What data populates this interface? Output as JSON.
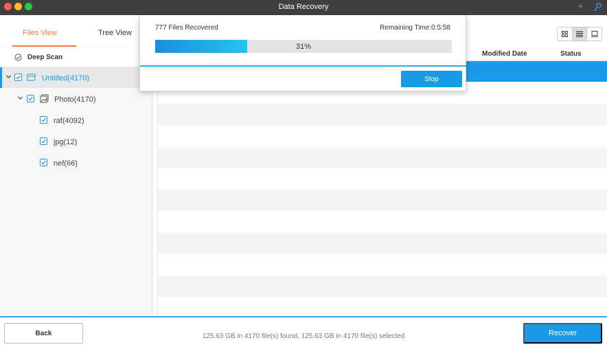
{
  "window": {
    "title": "Data Recovery"
  },
  "sidebar": {
    "tabs": [
      "Files View",
      "Tree View"
    ],
    "active_tab": "Files View",
    "deep_scan_label": "Deep Scan",
    "tree": [
      {
        "label": "Untitled(4170)",
        "icon": "drive-icon",
        "checked": true,
        "expanded": true,
        "selected": true
      },
      {
        "label": "Photo(4170)",
        "icon": "photo-folder-icon",
        "checked": true,
        "expanded": true
      },
      {
        "label": "raf(4092)",
        "checked": true
      },
      {
        "label": "jpg(12)",
        "checked": true
      },
      {
        "label": "nef(66)",
        "checked": true
      }
    ]
  },
  "main": {
    "columns": [
      "Modified Date",
      "Status"
    ],
    "view_modes": [
      "grid-view-icon",
      "list-view-icon",
      "preview-view-icon"
    ],
    "active_view": "list-view-icon"
  },
  "dialog": {
    "files_recovered": "777 Files Recovered",
    "remaining_time": "Remaining Time:0:5:58",
    "progress": 0.31,
    "progress_label": "31%",
    "stop_label": "Stop"
  },
  "footer": {
    "back_label": "Back",
    "status_text": "125.63 GB in 4170 file(s) found, 125.63 GB in 4170 file(s) selected",
    "recover_label": "Recover"
  },
  "colors": {
    "accent": "#1a9be6",
    "tab_active": "#f07a43",
    "titlebar": "#3f3f3f"
  }
}
